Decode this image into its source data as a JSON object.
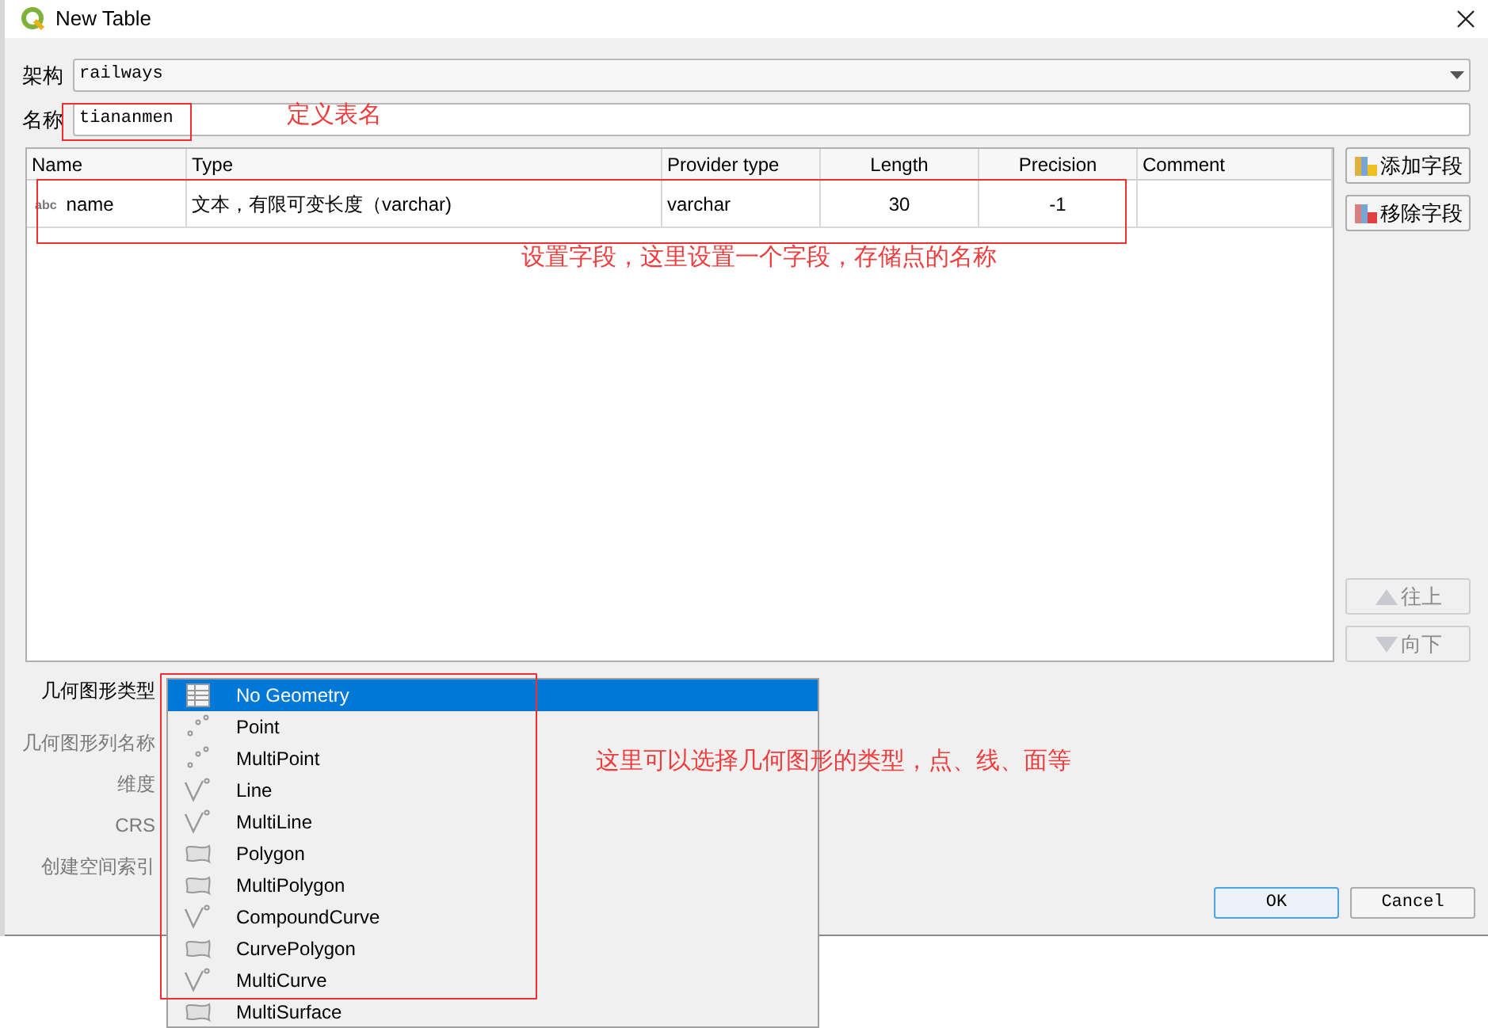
{
  "window": {
    "title": "New Table"
  },
  "form": {
    "schema": {
      "label": "架构",
      "value": "railways"
    },
    "name": {
      "label": "名称",
      "value": "tiananmen"
    }
  },
  "fields_table": {
    "columns": [
      "Name",
      "Type",
      "Provider type",
      "Length",
      "Precision",
      "Comment"
    ],
    "rows": [
      {
        "type_badge": "abc",
        "name": "name",
        "type": "文本，有限可变长度（varchar)",
        "provider_type": "varchar",
        "length": "30",
        "precision": "-1"
      }
    ]
  },
  "side_buttons": [
    {
      "label": "添加字段",
      "kind": "add",
      "disabled": false
    },
    {
      "label": "移除字段",
      "kind": "remove",
      "disabled": false
    },
    {
      "label": "往上",
      "kind": "up",
      "disabled": true
    },
    {
      "label": "向下",
      "kind": "down",
      "disabled": true
    }
  ],
  "geometry_labels": [
    {
      "label": "几何图形类型",
      "disabled": false
    },
    {
      "label": "几何图形列名称",
      "disabled": true
    },
    {
      "label": "维度",
      "disabled": true
    },
    {
      "label": "CRS",
      "disabled": true
    },
    {
      "label": "创建空间索引",
      "disabled": true
    }
  ],
  "geometry_dropdown": [
    {
      "label": "No Geometry",
      "kind": "table",
      "selected": true
    },
    {
      "label": "Point",
      "kind": "point",
      "selected": false
    },
    {
      "label": "MultiPoint",
      "kind": "point",
      "selected": false
    },
    {
      "label": "Line",
      "kind": "line",
      "selected": false
    },
    {
      "label": "MultiLine",
      "kind": "line",
      "selected": false
    },
    {
      "label": "Polygon",
      "kind": "polygon",
      "selected": false
    },
    {
      "label": "MultiPolygon",
      "kind": "polygon",
      "selected": false
    },
    {
      "label": "CompoundCurve",
      "kind": "line",
      "selected": false
    },
    {
      "label": "CurvePolygon",
      "kind": "polygon",
      "selected": false
    },
    {
      "label": "MultiCurve",
      "kind": "line",
      "selected": false
    },
    {
      "label": "MultiSurface",
      "kind": "polygon",
      "selected": false
    }
  ],
  "dialog_buttons": [
    {
      "label": "OK",
      "default": true
    },
    {
      "label": "Cancel",
      "default": false
    }
  ],
  "annotations": [
    "定义表名",
    "设置字段，这里设置一个字段，存储点的名称",
    "这里可以选择几何图形的类型，点、线、面等"
  ]
}
